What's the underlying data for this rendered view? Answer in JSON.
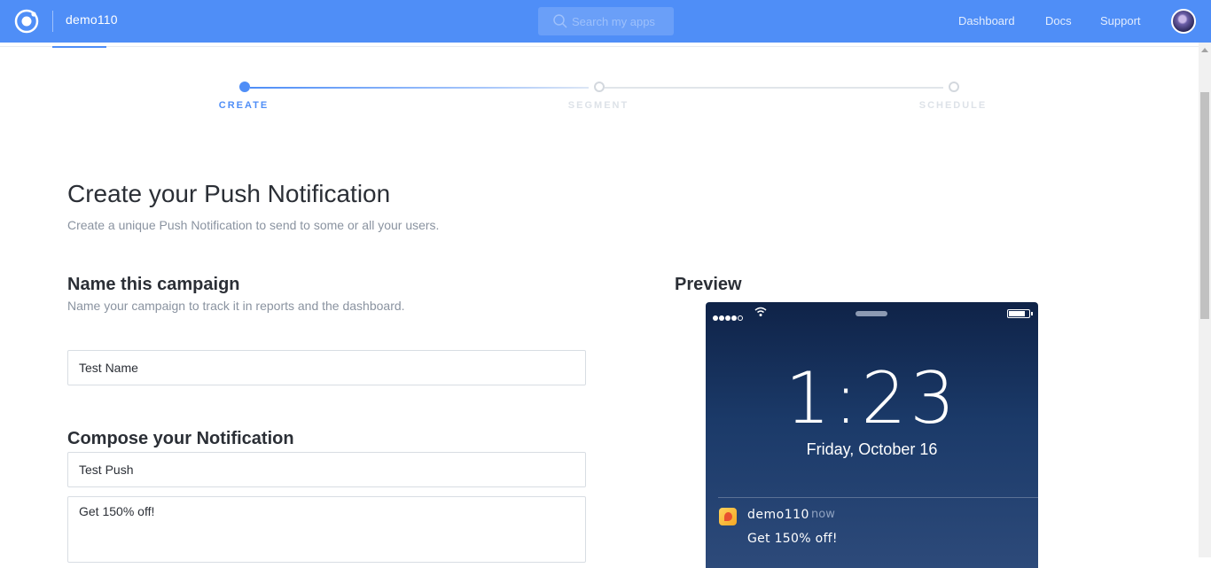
{
  "topbar": {
    "app_name": "demo110",
    "search_placeholder": "Search my apps",
    "nav": [
      "Dashboard",
      "Docs",
      "Support"
    ]
  },
  "stepper": {
    "steps": [
      "CREATE",
      "SEGMENT",
      "SCHEDULE"
    ],
    "active_step": "CREATE"
  },
  "page": {
    "title": "Create your Push Notification",
    "subtitle": "Create a unique Push Notification to send to some or all your users."
  },
  "campaign": {
    "title": "Name this campaign",
    "subtitle": "Name your campaign to track it in reports and the dashboard.",
    "name_value": "Test Name"
  },
  "compose": {
    "title": "Compose your Notification",
    "title_value": "Test Push",
    "message_value": "Get 150% off!"
  },
  "preview": {
    "title": "Preview",
    "time": "1:23",
    "date": "Friday, October 16",
    "notification_app": "demo110",
    "notification_time": "now",
    "notification_message": "Get 150% off!"
  },
  "colors": {
    "accent": "#4f8ef7",
    "topbar_bg": "#4f8ef7",
    "phone_bg": "#1b3a69"
  }
}
